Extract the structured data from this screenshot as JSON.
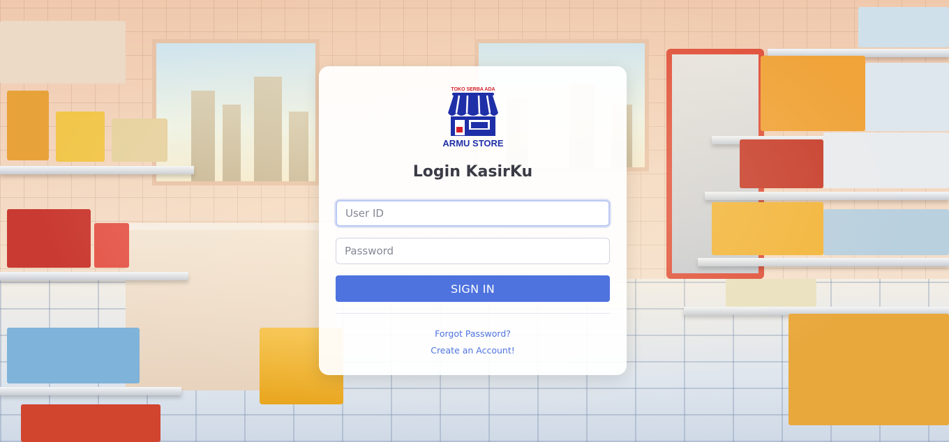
{
  "logo": {
    "tagline": "TOKO SERBA ADA",
    "name": "ARMU STORE",
    "colors": {
      "primary": "#1f2fa8",
      "accent": "#d4202b"
    }
  },
  "login": {
    "title": "Login KasirKu",
    "user_id_placeholder": "User ID",
    "password_placeholder": "Password",
    "sign_in_label": "SIGN IN",
    "forgot_password_label": "Forgot Password?",
    "create_account_label": "Create an Account!"
  },
  "theme": {
    "button_color": "#4e73df",
    "link_color": "#4e73df",
    "title_color": "#3a3b45"
  }
}
